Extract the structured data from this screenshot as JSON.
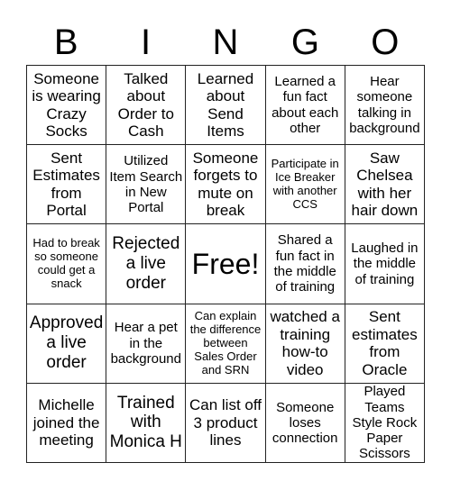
{
  "header": [
    "B",
    "I",
    "N",
    "G",
    "O"
  ],
  "cells": [
    {
      "text": "Someone is wearing Crazy Socks",
      "size": "s17"
    },
    {
      "text": "Talked about Order to Cash",
      "size": "s17"
    },
    {
      "text": "Learned about Send Items",
      "size": "s17"
    },
    {
      "text": "Learned a fun fact about each other",
      "size": "s15"
    },
    {
      "text": "Hear someone talking in background",
      "size": "s15"
    },
    {
      "text": "Sent Estimates from Portal",
      "size": "s17"
    },
    {
      "text": "Utilized Item Search in New Portal",
      "size": "s15"
    },
    {
      "text": "Someone forgets to mute on break",
      "size": "s17"
    },
    {
      "text": "Participate in Ice Breaker with another CCS",
      "size": "s13"
    },
    {
      "text": "Saw Chelsea with her hair down",
      "size": "s17"
    },
    {
      "text": "Had to break so someone could get a snack",
      "size": "s13"
    },
    {
      "text": "Rejected a live order",
      "size": "s19"
    },
    {
      "text": "Free!",
      "size": "free"
    },
    {
      "text": "Shared a fun fact in the middle of training",
      "size": "s15"
    },
    {
      "text": "Laughed in the middle of training",
      "size": "s15"
    },
    {
      "text": "Approved a live order",
      "size": "s19"
    },
    {
      "text": "Hear a pet in the background",
      "size": "s15"
    },
    {
      "text": "Can explain the difference between Sales Order and SRN",
      "size": "s13"
    },
    {
      "text": "watched a training how-to video",
      "size": "s17"
    },
    {
      "text": "Sent estimates from Oracle",
      "size": "s17"
    },
    {
      "text": "Michelle joined the meeting",
      "size": "s17"
    },
    {
      "text": "Trained with Monica H",
      "size": "s19"
    },
    {
      "text": "Can list off 3 product lines",
      "size": "s17"
    },
    {
      "text": "Someone loses connection",
      "size": "s15"
    },
    {
      "text": "Played Teams Style Rock Paper Scissors",
      "size": "s15"
    }
  ]
}
